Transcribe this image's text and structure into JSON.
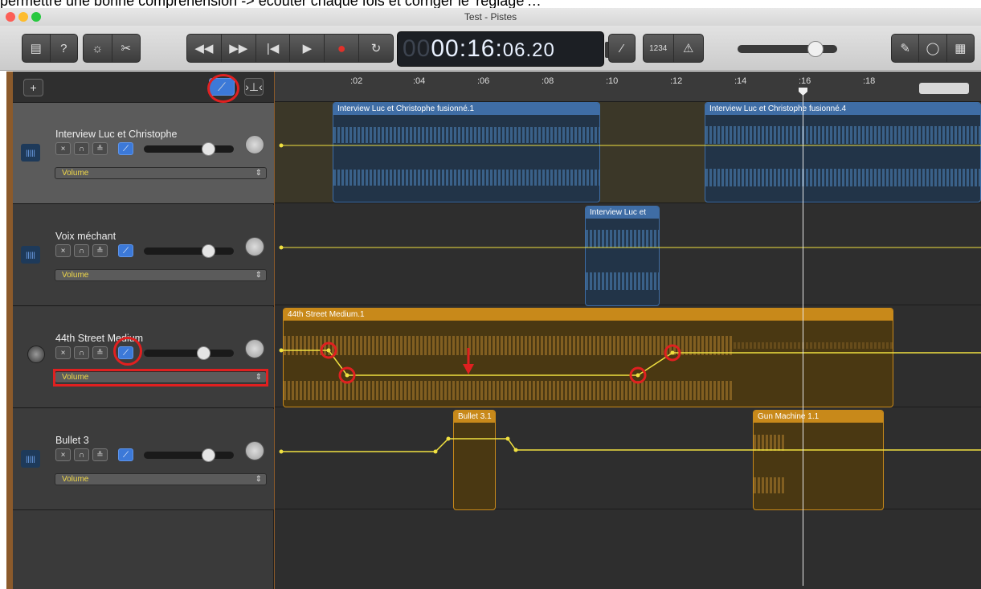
{
  "caption": "permettre une bonne compréhension -> écouter chaque fois et corriger le 'réglage'…",
  "window": {
    "title": "Test - Pistes"
  },
  "toolbar": {
    "lcd_prefix": "00",
    "lcd_main": "00:16:",
    "lcd_frac": "06.20",
    "count_in_label": "1234"
  },
  "header": {
    "add_label": "+"
  },
  "ruler": {
    "ticks": [
      ":02",
      ":04",
      ":06",
      ":08",
      ":10",
      ":12",
      ":14",
      ":16",
      ":18"
    ]
  },
  "tracks": [
    {
      "name": "Interview Luc et Christophe",
      "param": "Volume"
    },
    {
      "name": "Voix méchant",
      "param": "Volume"
    },
    {
      "name": "44th Street Medium",
      "param": "Volume"
    },
    {
      "name": "Bullet 3",
      "param": "Volume"
    }
  ],
  "regions": {
    "r1": "Interview Luc et Christophe fusionné.1",
    "r2": "Interview Luc et Christophe fusionné.4",
    "r3": "Interview Luc et",
    "r4": "44th Street Medium.1",
    "r5": "Bullet 3.1",
    "r6": "Gun Machine 1.1"
  },
  "colors": {
    "accent_red": "#e02020",
    "automation": "#f0e040"
  }
}
